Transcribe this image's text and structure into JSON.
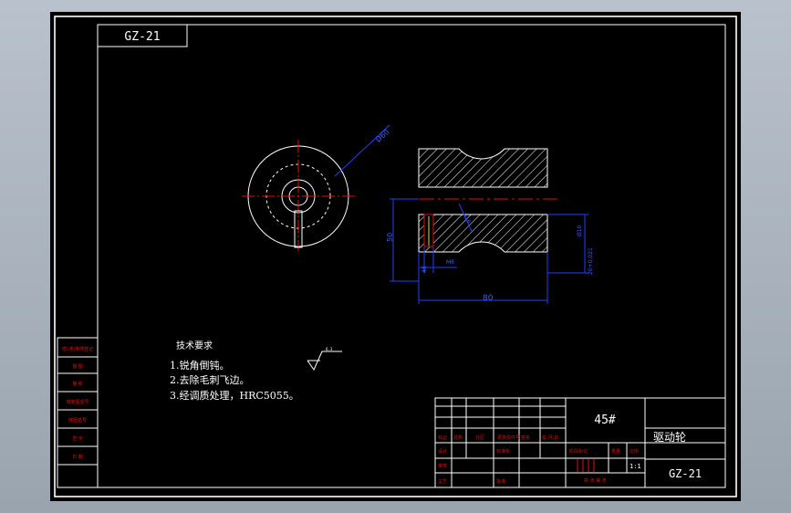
{
  "drawing": {
    "code_box": "GZ-21",
    "dimensions": {
      "dia_outer": "Ø60",
      "height": "50",
      "length": "80",
      "radius": "R16",
      "hole": "Ø10",
      "keyway": "M6",
      "side_h": "40",
      "fit": "20+0.021"
    },
    "tech": {
      "heading": "技术要求",
      "notes": [
        "1.锐角倒钝。",
        "2.去除毛刺飞边。",
        "3.经调质处理，HRC5055。"
      ],
      "roughness": "6.3"
    },
    "side_labels": [
      "借(通)用件登记",
      "描  图",
      "描  校",
      "旧底图总号",
      "底图总号",
      "签  字",
      "日  期"
    ],
    "title_block": {
      "material": "45#",
      "part_name": "驱动轮",
      "drawing_no": "GZ-21",
      "scale": "1:1",
      "headers": [
        "标记",
        "处数",
        "分区",
        "更改文件号",
        "签名",
        "年.月.日"
      ],
      "roles": [
        "设计",
        "审核",
        "工艺"
      ],
      "std": "标准化",
      "sign_date": "批准",
      "stage": "阶段标记",
      "weight": "重量",
      "scale_label": "比例",
      "sheet": "共  张  第  张"
    }
  }
}
